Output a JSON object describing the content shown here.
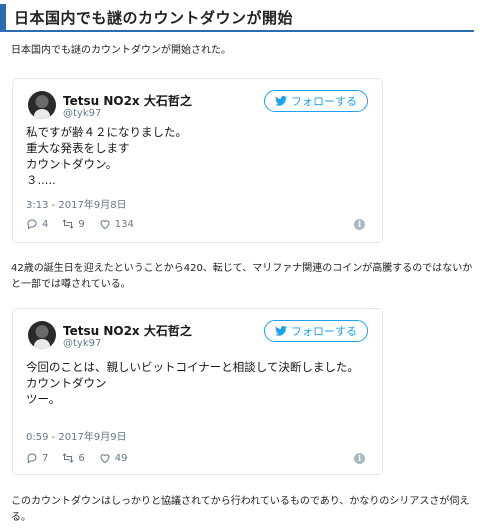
{
  "heading": "日本国内でも謎のカウントダウンが開始",
  "paragraphs": {
    "p1": "日本国内でも謎のカウントダウンが開始された。",
    "p2": "42歳の誕生日を迎えたということから420、転じて、マリファナ関連のコインが高騰するのではないかと一部では噂されている。",
    "p3": "このカウントダウンはしっかりと協議されてから行われているものであり、かなりのシリアスさが伺える。"
  },
  "tweets": [
    {
      "name": "Tetsu NO2x 大石哲之",
      "handle": "@tyk97",
      "follow_label": "フォローする",
      "body": "私ですが齢４２になりました。\n重大な発表をします\nカウントダウン。\n３.....",
      "date": "3:13 - 2017年9月8日",
      "replies": "4",
      "retweets": "9",
      "likes": "134"
    },
    {
      "name": "Tetsu NO2x 大石哲之",
      "handle": "@tyk97",
      "follow_label": "フォローする",
      "body": "今回のことは、親しいビットコイナーと相談して決断しました。\nカウントダウン\nツー。",
      "date": "0:59 - 2017年9月9日",
      "replies": "7",
      "retweets": "6",
      "likes": "49"
    }
  ],
  "icons": {
    "reply": "reply-icon",
    "retweet": "retweet-icon",
    "like": "heart-icon",
    "info": "info-icon",
    "follow": "twitter-bird-icon"
  },
  "colors": {
    "accent": "#2b6cb0",
    "twitter_blue": "#1da1f2",
    "muted": "#657786"
  }
}
